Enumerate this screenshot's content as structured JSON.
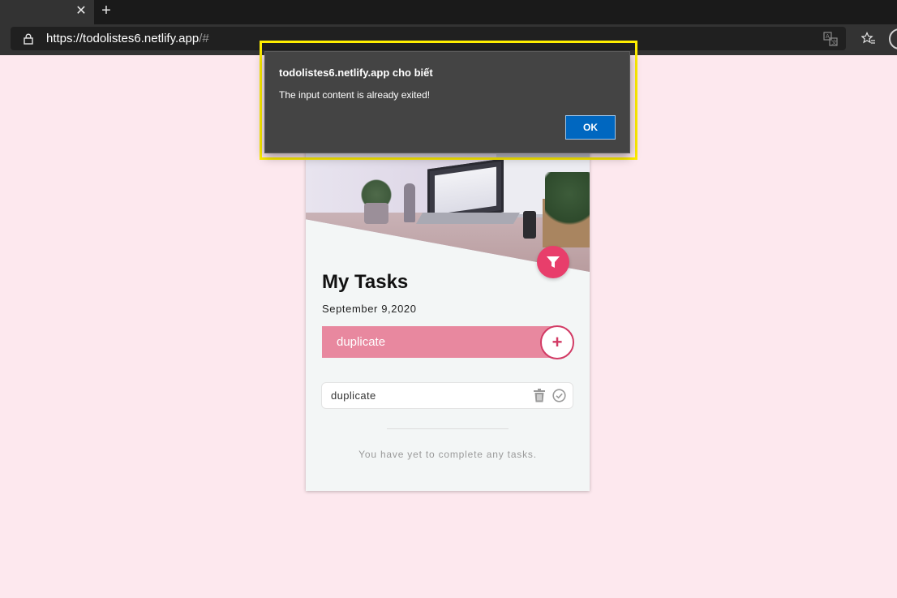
{
  "browser": {
    "tab_close": "✕",
    "new_tab": "+",
    "url_scheme": "https://",
    "url_host": "todolistes6.netlify.app",
    "url_path": "/#",
    "icons": [
      "lock-icon",
      "translate-icon",
      "favorites-icon",
      "profile-icon"
    ]
  },
  "app": {
    "title": "My Tasks",
    "date": "September 9,2020",
    "add_input_value": "duplicate",
    "add_button_label": "+",
    "tasks": [
      {
        "text": "duplicate"
      }
    ],
    "empty_message": "You have yet to complete any tasks.",
    "accent_color": "#e83e6b",
    "input_bar_color": "#e8889f",
    "background_color": "#fde8ee"
  },
  "dialog": {
    "title": "todolistes6.netlify.app cho biết",
    "message": "The input content is already exited!",
    "ok_label": "OK"
  }
}
